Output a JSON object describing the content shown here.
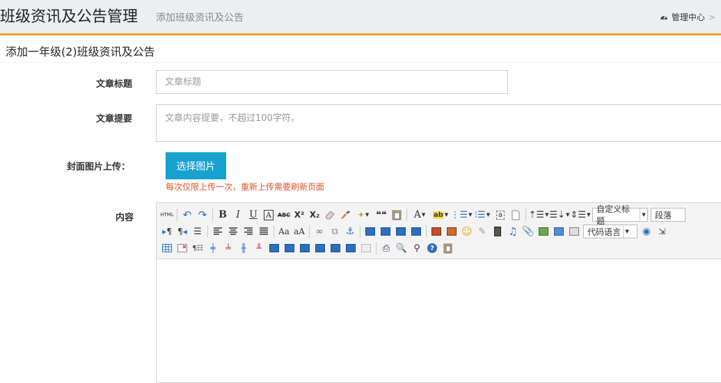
{
  "header": {
    "title": "班级资讯及公告管理",
    "subtitle": "添加班级资讯及公告",
    "breadcrumb_home": "管理中心",
    "breadcrumb_sep": ">"
  },
  "form_header": {
    "title": "添加一年级(2)班级资讯及公告"
  },
  "form": {
    "title_label": "文章标题",
    "title_placeholder": "文章标题",
    "summary_label": "文章提要",
    "summary_placeholder": "文章内容提要，不超过100字符。",
    "cover_label": "封面图片上传：",
    "upload_button": "选择图片",
    "upload_hint": "每次仅限上传一次，重新上传需要刷新页面",
    "content_label": "内容"
  },
  "editor": {
    "heading_combo": "自定义标题",
    "paragraph_combo": "段落",
    "code_combo": "代码语言",
    "html_button": "HTML",
    "quote_glyph": "❝❝"
  },
  "colors": {
    "accent": "#f0a030",
    "button": "#17a2d0",
    "hint": "#e0522a"
  }
}
